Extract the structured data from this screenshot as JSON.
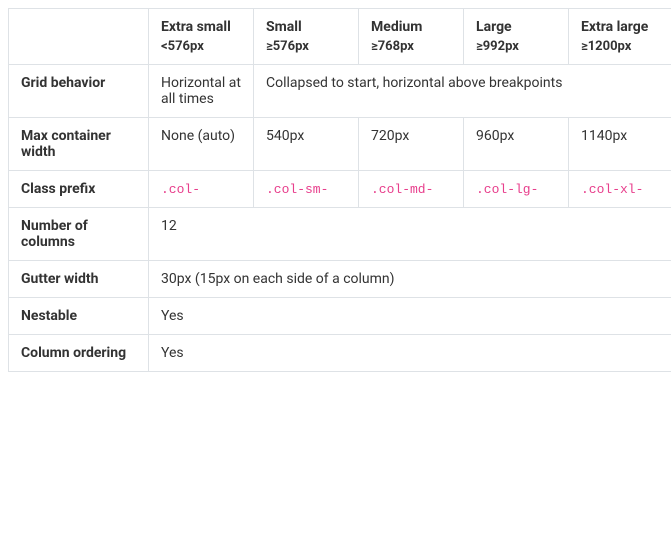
{
  "headers": [
    {
      "title": "Extra small",
      "sub": "<576px"
    },
    {
      "title": "Small",
      "sub": "≥576px"
    },
    {
      "title": "Medium",
      "sub": "≥768px"
    },
    {
      "title": "Large",
      "sub": "≥992px"
    },
    {
      "title": "Extra large",
      "sub": "≥1200px"
    }
  ],
  "rows": {
    "grid_behavior": {
      "label": "Grid behavior",
      "xs": "Horizontal at all times",
      "rest": "Collapsed to start, horizontal above breakpoints"
    },
    "max_container_width": {
      "label": "Max container width",
      "xs": "None (auto)",
      "sm": "540px",
      "md": "720px",
      "lg": "960px",
      "xl": "1140px"
    },
    "class_prefix": {
      "label": "Class prefix",
      "xs": ".col-",
      "sm": ".col-sm-",
      "md": ".col-md-",
      "lg": ".col-lg-",
      "xl": ".col-xl-"
    },
    "num_columns": {
      "label": "Number of columns",
      "value": "12"
    },
    "gutter_width": {
      "label": "Gutter width",
      "value": "30px (15px on each side of a column)"
    },
    "nestable": {
      "label": "Nestable",
      "value": "Yes"
    },
    "column_ordering": {
      "label": "Column ordering",
      "value": "Yes"
    }
  }
}
